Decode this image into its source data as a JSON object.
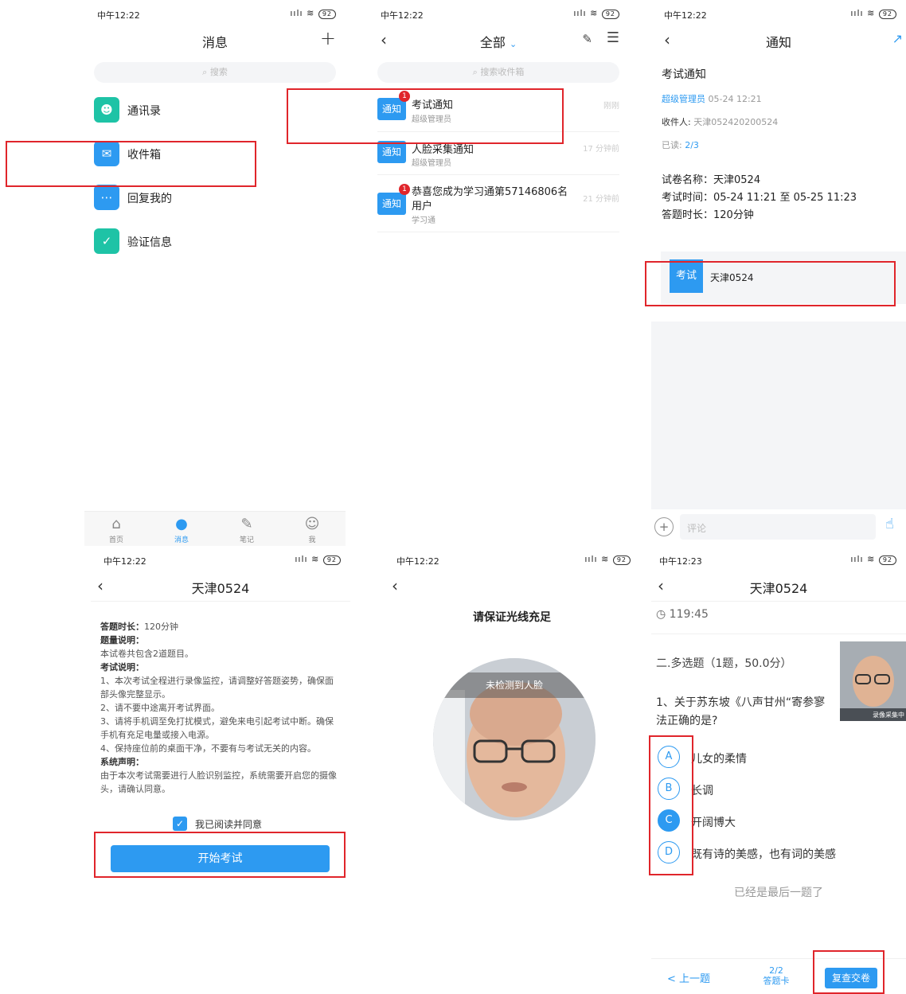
{
  "panel1": {
    "status": {
      "time": "中午12:22",
      "battery": "92"
    },
    "title": "消息",
    "add_icon": "+",
    "search_placeholder": "搜索",
    "menu": [
      {
        "label": "通讯录",
        "icon": "contacts-icon",
        "color": "#1ec3a6"
      },
      {
        "label": "收件箱",
        "icon": "inbox-icon",
        "color": "#2d9af1"
      },
      {
        "label": "回复我的",
        "icon": "reply-icon",
        "color": "#2d9af1"
      },
      {
        "label": "验证信息",
        "icon": "verify-icon",
        "color": "#1ec3a6"
      }
    ],
    "tabs": [
      {
        "label": "首页",
        "icon": "home-icon"
      },
      {
        "label": "消息",
        "icon": "message-icon"
      },
      {
        "label": "笔记",
        "icon": "note-icon"
      },
      {
        "label": "我",
        "icon": "profile-icon"
      }
    ]
  },
  "panel2": {
    "status": {
      "time": "中午12:22",
      "battery": "92"
    },
    "title": "全部",
    "search_placeholder": "搜索收件箱",
    "messages": [
      {
        "tag": "通知",
        "badge": "1",
        "title": "考试通知",
        "sub": "超级管理员",
        "time": "刚刚"
      },
      {
        "tag": "通知",
        "badge": "",
        "title": "人脸采集通知",
        "sub": "超级管理员",
        "time": "17 分钟前"
      },
      {
        "tag": "通知",
        "badge": "1",
        "title_line1": "恭喜您成为学习通第57146806名",
        "title_line2": "用户",
        "sub": "学习通",
        "time": "21 分钟前"
      }
    ]
  },
  "panel3": {
    "status": {
      "time": "中午12:22",
      "battery": "92"
    },
    "title": "通知",
    "heading": "考试通知",
    "sender": "超级管理员",
    "date": "05-24 12:21",
    "recipient_label": "收件人:",
    "recipient": "天津052420200524",
    "read_label": "已读:",
    "read_value": "2/3",
    "body": [
      "试卷名称：天津0524",
      "考试时间：05-24 11:21 至 05-25 11:23",
      "答题时长：120分钟"
    ],
    "card_tag": "考试",
    "card_title": "天津0524",
    "comment_placeholder": "评论"
  },
  "panel4": {
    "status": {
      "time": "中午12:22",
      "battery": "92"
    },
    "title": "天津0524",
    "rules": [
      {
        "bold": "答题时长：",
        "text": "120分钟"
      },
      {
        "bold": "题量说明：",
        "text": ""
      },
      {
        "bold": "",
        "text": "本试卷共包含2道题目。"
      },
      {
        "bold": "考试说明：",
        "text": ""
      },
      {
        "bold": "",
        "text": "1、本次考试全程进行录像监控，请调整好答题姿势，确保面部头像完整显示。"
      },
      {
        "bold": "",
        "text": "2、请不要中途离开考试界面。"
      },
      {
        "bold": "",
        "text": "3、请将手机调至免打扰模式，避免来电引起考试中断。确保手机有充足电量或接入电源。"
      },
      {
        "bold": "",
        "text": "4、保持座位前的桌面干净，不要有与考试无关的内容。"
      },
      {
        "bold": "系统声明：",
        "text": ""
      },
      {
        "bold": "",
        "text": "由于本次考试需要进行人脸识别监控，系统需要开启您的摄像头，请确认同意。"
      }
    ],
    "agree_label": "我已阅读并同意",
    "agree_checked": true,
    "start_button": "开始考试"
  },
  "panel5": {
    "status": {
      "time": "中午12:22",
      "battery": "92"
    },
    "prompt": "请保证光线充足",
    "face_status": "未检测到人脸"
  },
  "panel6": {
    "status": {
      "time": "中午12:23",
      "battery": "92"
    },
    "title": "天津0524",
    "timer": "119:45",
    "section": "二.多选题（1题，50.0分）",
    "question_line1": "1、关于苏东坡《八声甘州“寄参寥",
    "question_line2": "法正确的是?",
    "camera_label": "录像采集中",
    "options": [
      {
        "key": "A",
        "text": "儿女的柔情",
        "selected": false
      },
      {
        "key": "B",
        "text": "长调",
        "selected": false
      },
      {
        "key": "C",
        "text": "开阔博大",
        "selected": true
      },
      {
        "key": "D",
        "text": "既有诗的美感，也有词的美感",
        "selected": false
      }
    ],
    "last_hint": "已经是最后一题了",
    "prev_button": "< 上一题",
    "progress": "2/2",
    "card_button": "答题卡",
    "submit_button": "复查交卷"
  }
}
